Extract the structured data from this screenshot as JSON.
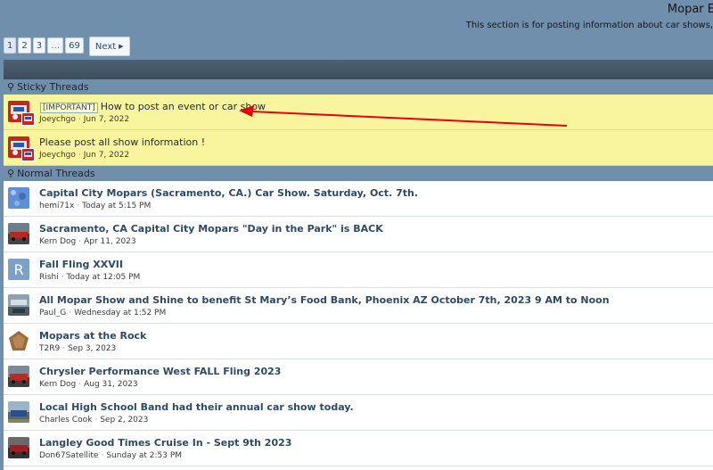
{
  "forum": {
    "title": "Mopar E",
    "description": "This section is for posting information about car shows,"
  },
  "pagination": {
    "pages": [
      "1",
      "2",
      "3",
      "…",
      "69"
    ],
    "current": "1",
    "next_label": "Next"
  },
  "sections": {
    "sticky_label": "Sticky Threads",
    "normal_label": "Normal Threads"
  },
  "sticky_threads": [
    {
      "prefix": "[IMPORTANT]",
      "title": "How to post an event or car show",
      "author": "Joeychgo",
      "date": "Jun 7, 2022"
    },
    {
      "prefix": "",
      "title": "Please post all show information !",
      "author": "Joeychgo",
      "date": "Jun 7, 2022"
    }
  ],
  "threads": [
    {
      "title": "Capital City Mopars (Sacramento, CA.) Car Show. Saturday, Oct. 7th.",
      "author": "hemi71x",
      "date": "Today at 5:15 PM"
    },
    {
      "title": "Sacramento, CA Capital City Mopars \"Day in the Park\" is BACK",
      "author": "Kern Dog",
      "date": "Apr 11, 2023"
    },
    {
      "title": "Fall Fling XXVII",
      "author": "Rishi",
      "date": "Today at 12:05 PM",
      "avatar_letter": "R"
    },
    {
      "title": "All Mopar Show and Shine to benefit St Mary’s Food Bank, Phoenix AZ October 7th, 2023 9 AM to Noon",
      "author": "Paul_G",
      "date": "Wednesday at 1:52 PM"
    },
    {
      "title": "Mopars at the Rock",
      "author": "T2R9",
      "date": "Sep 3, 2023"
    },
    {
      "title": "Chrysler Performance West FALL Fling 2023",
      "author": "Kern Dog",
      "date": "Aug 31, 2023"
    },
    {
      "title": "Local High School Band had their annual car show today.",
      "author": "Charles Cook",
      "date": "Sep 2, 2023"
    },
    {
      "title": "Langley Good Times Cruise In - Sept 9th 2023",
      "author": "Don67Satellite",
      "date": "Sunday at 2:53 PM"
    }
  ],
  "icons": {
    "pin": "pin-icon",
    "next": "chevron-right-icon"
  },
  "colors": {
    "sticky_bg": "#f8f59e",
    "header_bg": "#6f8fad",
    "link": "#2d4a64",
    "arrow": "#e8000b"
  }
}
